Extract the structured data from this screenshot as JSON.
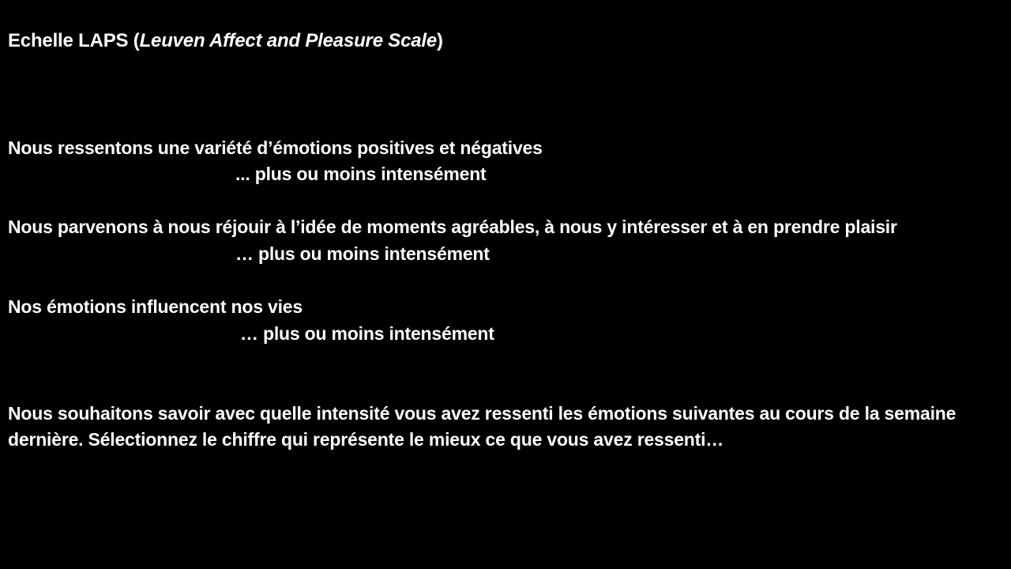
{
  "slide": {
    "background": "#000000",
    "text_color": "#ffffff",
    "title": {
      "prefix": "Echelle LAPS (",
      "italic": "Leuven Affect and Pleasure Scale",
      "suffix": ")"
    },
    "statements": [
      {
        "text": "Nous ressentons une variété d’émotions positives et négatives",
        "qualifier": "... plus ou moins intensément"
      },
      {
        "text": "Nous parvenons à nous réjouir à l’idée de moments agréables, à nous y intéresser et à en prendre plaisir",
        "qualifier": "… plus ou moins intensément"
      },
      {
        "text": "Nos émotions influencent nos vies",
        "qualifier": "… plus ou moins intensément"
      }
    ],
    "instruction": "Nous souhaitons savoir avec quelle intensité vous avez ressenti les émotions suivantes au cours de la semaine dernière. Sélectionnez le chiffre qui représente le mieux ce que vous avez ressenti…"
  }
}
